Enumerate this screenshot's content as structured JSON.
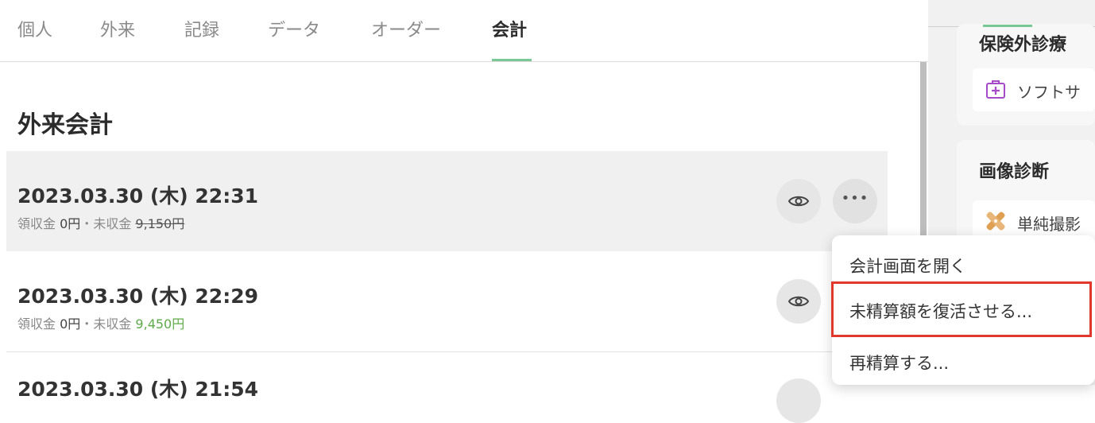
{
  "tabs": [
    {
      "label": "個人"
    },
    {
      "label": "外来"
    },
    {
      "label": "記録"
    },
    {
      "label": "データ"
    },
    {
      "label": "オーダー"
    },
    {
      "label": "会計"
    }
  ],
  "active_tab": "会計",
  "section_title": "外来会計",
  "visits": [
    {
      "datetime": "2023.03.30 (木) 22:31",
      "received_label": "領収金",
      "received_amount": "0円",
      "separator": "・",
      "unpaid_label": "未収金",
      "unpaid_amount": "9,150円",
      "unpaid_struck": true
    },
    {
      "datetime": "2023.03.30 (木) 22:29",
      "received_label": "領収金",
      "received_amount": "0円",
      "separator": "・",
      "unpaid_label": "未収金",
      "unpaid_amount": "9,450円",
      "unpaid_struck": false
    },
    {
      "datetime_partial": "2023.03.30 (木) 21:54"
    }
  ],
  "right_panel": {
    "cards": [
      {
        "title": "保険外診療",
        "item_label": "ソフトサ",
        "item_icon": "medical-kit-icon"
      },
      {
        "title": "画像診断",
        "item_label": "単純撮影",
        "item_icon": "bandage-icon"
      }
    ]
  },
  "context_menu": {
    "items": [
      {
        "label": "会計画面を開く"
      },
      {
        "label": "未精算額を復活させる..."
      },
      {
        "label": "再精算する..."
      }
    ],
    "highlighted_index": 1
  },
  "colors": {
    "accent_green": "#7ac796",
    "amount_green": "#5fab4a",
    "highlight_red": "#e0392c",
    "icon_purple": "#a64ac9",
    "icon_orange": "#e0a052"
  }
}
